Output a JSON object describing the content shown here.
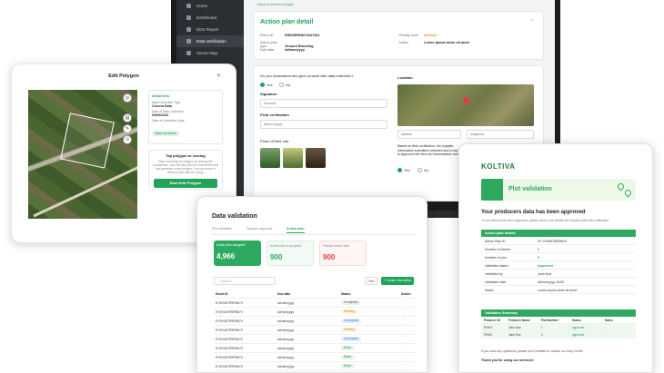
{
  "laptop": {
    "back_link": "Back to previous page",
    "sidebar": [
      {
        "label": "Home"
      },
      {
        "label": "Dashboard"
      },
      {
        "label": "DDS Report"
      },
      {
        "label": "Data Verification"
      },
      {
        "label": "Sector Map"
      }
    ],
    "action_plan": {
      "title": "Action plan detail",
      "fields": [
        {
          "k": "Event ID",
          "v": "EID00RRNN72347401"
        },
        {
          "k": "Action plan type",
          "v": "Ground Brushing"
        },
        {
          "k": "Due date",
          "v": "dd/mm/yyyy"
        }
      ],
      "priority_label": "Priority level",
      "priority_value": "Medium",
      "notes_label": "Notes",
      "notes_value": "Lorem ipsum dolor sit amet"
    },
    "consent": {
      "question": "Do you understand and give consent with data collection?",
      "yes": "Yes",
      "no": "No",
      "signature_label": "Signature",
      "signature_value": "Smooth",
      "field_verification_label": "Field verification",
      "date_placeholder": "dd/mm/yyyy",
      "photo_label": "Photo of field visit",
      "location_label": "Location",
      "latitude": "latitude",
      "longitude": "longitude",
      "based_on": "Based on field verification, the supplier information submitted collected and a has stated it is approved the farm as Deforestation risk",
      "yes2": "Yes",
      "no2": "No"
    }
  },
  "edit_polygon": {
    "title": "Edit Polygon",
    "panel_header": "Detail Info",
    "rows": [
      {
        "k": "Map Correction Type",
        "v": "Current Data"
      },
      {
        "k": "Date of Data Collection",
        "v": "03/05/2023"
      },
      {
        "k": "Date of Correction Type",
        "v": "Data Correction"
      }
    ],
    "tap_title": "Tap polygon to closing",
    "tap_desc": "Start recording the polygon by clicking the coordinates. Click the last point to connect the lines and generate a new polygon. You can move or delete points that are wrong.",
    "start_button": "Start Edit Polygon"
  },
  "data_validation": {
    "title": "Data validation",
    "tabs": [
      "Plot validation",
      "Supplier approval",
      "Action plan"
    ],
    "stats": [
      {
        "label": "Action plan assigned",
        "value": "4,966"
      },
      {
        "label": "Action plan in progress",
        "value": "900"
      },
      {
        "label": "Passed action date",
        "value": "900"
      }
    ],
    "search_placeholder": "Search",
    "filter_label": "Filter",
    "create_label": "+ Create new action plan",
    "columns": [
      "Event ID",
      "Due date",
      "Status",
      "Action"
    ],
    "rows": [
      {
        "id": "EY2H4D7R9P8N7V",
        "due": "dd/mm/yyyy",
        "status": "Completed"
      },
      {
        "id": "EY2H4D7R9P8N7V",
        "due": "dd/mm/yyyy",
        "status": "Pending"
      },
      {
        "id": "EY2H4D7R9P8N7V",
        "due": "dd/mm/yyyy",
        "status": "In progress"
      },
      {
        "id": "EY2H4D7R9P8N7V",
        "due": "dd/mm/yyyy",
        "status": "Pending"
      },
      {
        "id": "EY2H4D7R9P8N7V",
        "due": "dd/mm/yyyy",
        "status": "In progress"
      },
      {
        "id": "EY2H4D7R9P8N7V",
        "due": "dd/mm/yyyy",
        "status": "Done"
      },
      {
        "id": "EY2H4D7R9P8N7V",
        "due": "dd/mm/yyyy",
        "status": "Done"
      },
      {
        "id": "EY2H4D7R9P8N7V",
        "due": "dd/mm/yyyy",
        "status": "Done"
      },
      {
        "id": "EY2H4D7R9P8N7V",
        "due": "dd/mm/yyyy",
        "status": "Done"
      }
    ]
  },
  "koltiva": {
    "logo": "KOLTIVA",
    "banner_title": "Plot validation",
    "heading": "Your producers data has been approved",
    "desc": "To see which plots were approved, please view in the details the included with this notification.",
    "box_title": "Action plan details",
    "details": [
      {
        "k": "Action Plan ID",
        "v": "G7 2345678909876"
      },
      {
        "k": "Number of farmer",
        "v": "2"
      },
      {
        "k": "Number of plot",
        "v": "3"
      },
      {
        "k": "Validation status",
        "v": "Approved"
      },
      {
        "k": "Validated by",
        "v": "John Doe"
      },
      {
        "k": "Validation date",
        "v": "dd/mm/yyyy 16:52"
      },
      {
        "k": "Notes",
        "v": "Lorem ipsum dolor sit amet"
      }
    ],
    "summary_title": "Validation Summary",
    "summary_cols": [
      "Producer ID",
      "Producer Name",
      "Plot Number",
      "Status",
      "Notes"
    ],
    "summary_rows": [
      {
        "a": "P0001",
        "b": "John Doe",
        "c": "1",
        "d": "approved",
        "e": "-"
      },
      {
        "a": "P0002",
        "b": "Jane Doe",
        "c": "2",
        "d": "approved",
        "e": "-"
      }
    ],
    "footer1": "If you have any questions, please don't hesitate to contact our Help Center",
    "footer2": "Thank you for using our services!"
  },
  "colors": {
    "accent": "#22a35a",
    "sidebar": "#2b2f33",
    "orange": "#e39a2b"
  }
}
